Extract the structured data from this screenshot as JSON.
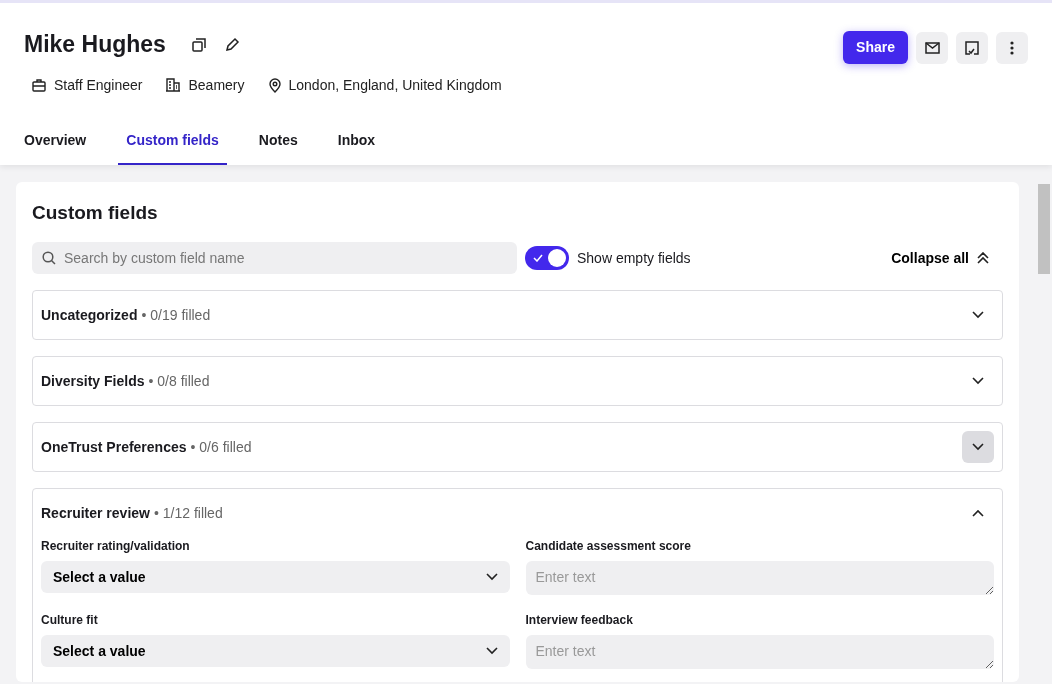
{
  "profile": {
    "name": "Mike Hughes",
    "details": [
      {
        "kind": "job",
        "text": "Staff Engineer"
      },
      {
        "kind": "company",
        "text": "Beamery"
      },
      {
        "kind": "location",
        "text": "London, England, United Kingdom"
      }
    ]
  },
  "actions": {
    "share": "Share"
  },
  "tabs": [
    {
      "label": "Overview",
      "selected": false
    },
    {
      "label": "Custom fields",
      "selected": true
    },
    {
      "label": "Notes",
      "selected": false
    },
    {
      "label": "Inbox",
      "selected": false
    }
  ],
  "panel": {
    "title": "Custom fields",
    "search": {
      "placeholder": "Search by custom field name"
    },
    "show_empty": {
      "label": "Show empty fields",
      "on": true
    },
    "collapse_all": "Collapse all"
  },
  "groups": [
    {
      "name": "Uncategorized",
      "count": "• 0/19 filled",
      "expanded": false,
      "highlighted": false
    },
    {
      "name": "Diversity Fields",
      "count": "• 0/8 filled",
      "expanded": false,
      "highlighted": false
    },
    {
      "name": "OneTrust Preferences",
      "count": "• 0/6 filled",
      "expanded": false,
      "highlighted": true
    },
    {
      "name": "Recruiter review",
      "count": "• 1/12 filled",
      "expanded": true,
      "highlighted": false,
      "fields": [
        {
          "kind": "select",
          "label": "Recruiter rating/validation",
          "value": "Select a value"
        },
        {
          "kind": "text",
          "label": "Candidate assessment score",
          "placeholder": "Enter text"
        },
        {
          "kind": "select",
          "label": "Culture fit",
          "value": "Select a value"
        },
        {
          "kind": "text",
          "label": "Interview feedback",
          "placeholder": "Enter text"
        }
      ]
    }
  ]
}
